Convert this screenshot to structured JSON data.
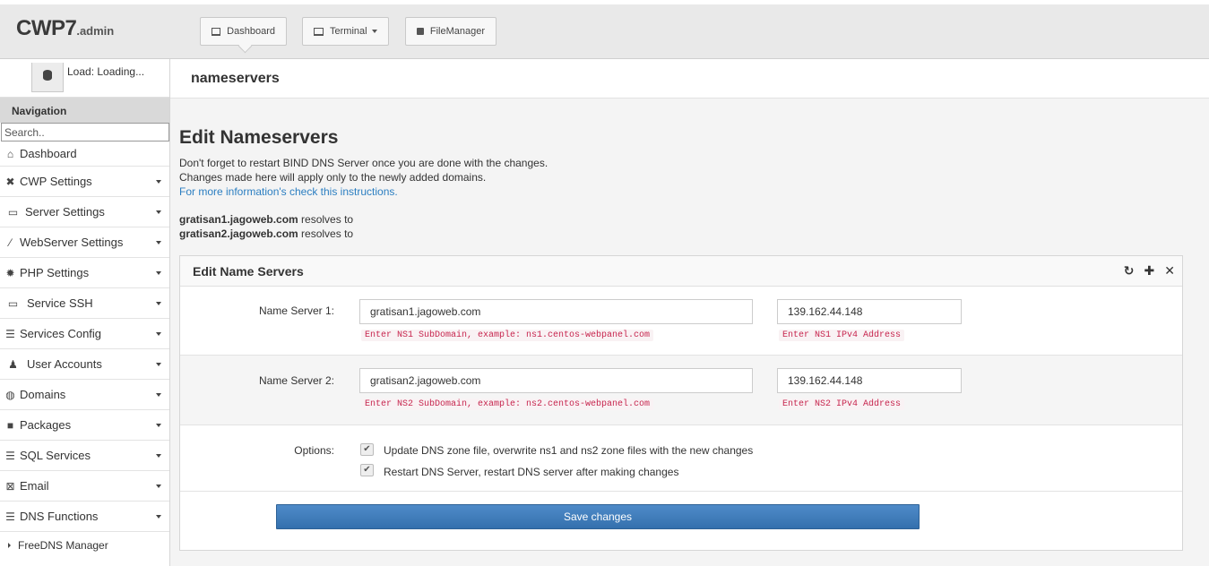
{
  "brand": {
    "name": "CWP7",
    "suffix": ".admin"
  },
  "top_buttons": {
    "dashboard": "Dashboard",
    "terminal": "Terminal",
    "filemanager": "FileManager"
  },
  "load": {
    "text": "Load: Loading..."
  },
  "nav": {
    "heading": "Navigation",
    "search_placeholder": "Search..",
    "items": [
      {
        "label": "Dashboard",
        "icon": "home-icon"
      },
      {
        "label": "CWP Settings",
        "icon": "tools-icon"
      },
      {
        "label": "Server Settings",
        "icon": "monitor-icon"
      },
      {
        "label": "WebServer Settings",
        "icon": "feather-icon"
      },
      {
        "label": "PHP Settings",
        "icon": "gear-icon"
      },
      {
        "label": "Service SSH",
        "icon": "monitor-icon"
      },
      {
        "label": "Services Config",
        "icon": "list-icon"
      },
      {
        "label": "User Accounts",
        "icon": "user-icon"
      },
      {
        "label": "Domains",
        "icon": "globe-icon"
      },
      {
        "label": "Packages",
        "icon": "cubes-icon"
      },
      {
        "label": "SQL Services",
        "icon": "database-icon"
      },
      {
        "label": "Email",
        "icon": "envelope-icon"
      },
      {
        "label": "DNS Functions",
        "icon": "server-icon"
      }
    ],
    "sub_item": "FreeDNS Manager"
  },
  "page": {
    "header": "nameservers",
    "title": "Edit Nameservers",
    "info_line1": "Don't forget to restart BIND DNS Server once you are done with the changes.",
    "info_line2": "Changes made here will apply only to the newly added domains.",
    "info_link": "For more information's check this instructions.",
    "resolve1_host": "gratisan1.jagoweb.com",
    "resolve2_host": "gratisan2.jagoweb.com",
    "resolves_text": "resolves to"
  },
  "panel": {
    "title": "Edit Name Servers",
    "ns1": {
      "label": "Name Server 1:",
      "host": "gratisan1.jagoweb.com",
      "ip": "139.162.44.148",
      "host_hint": "Enter NS1 SubDomain, example: ns1.centos-webpanel.com",
      "ip_hint": "Enter NS1 IPv4 Address"
    },
    "ns2": {
      "label": "Name Server 2:",
      "host": "gratisan2.jagoweb.com",
      "ip": "139.162.44.148",
      "host_hint": "Enter NS2 SubDomain, example: ns2.centos-webpanel.com",
      "ip_hint": "Enter NS2 IPv4 Address"
    },
    "options_label": "Options:",
    "option1": "Update DNS zone file, overwrite ns1 and ns2 zone files with the new changes",
    "option2": "Restart DNS Server, restart DNS server after making changes",
    "save_label": "Save changes"
  }
}
